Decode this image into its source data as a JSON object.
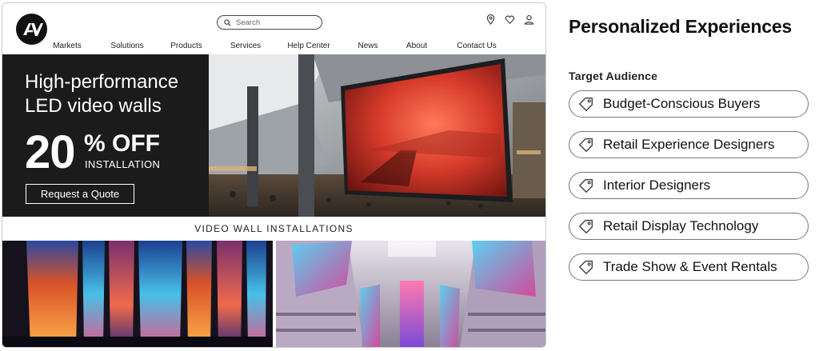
{
  "site": {
    "logo_text": "AV",
    "search": {
      "placeholder": "Search"
    },
    "nav": [
      "Markets",
      "Solutions",
      "Products",
      "Services",
      "Help Center",
      "News",
      "About",
      "Contact Us"
    ],
    "top_icons": [
      "location-icon",
      "heart-icon",
      "user-icon"
    ]
  },
  "hero": {
    "title_line1": "High-performance",
    "title_line2": "LED video walls",
    "discount_number": "20",
    "discount_suffix": "% OFF",
    "discount_subject": "INSTALLATION",
    "cta_label": "Request a Quote"
  },
  "section": {
    "title": "VIDEO WALL INSTALLATIONS"
  },
  "panel": {
    "title": "Personalized Experiences",
    "audience_label": "Target Audience",
    "tags": [
      "Budget-Conscious Buyers",
      "Retail Experience Designers",
      "Interior Designers",
      "Retail Display Technology",
      "Trade Show & Event Rentals"
    ],
    "tag_icon": "tag-icon"
  },
  "colors": {
    "hero_bg": "#1b1b1b",
    "tag_border": "#777777",
    "text": "#111111"
  }
}
